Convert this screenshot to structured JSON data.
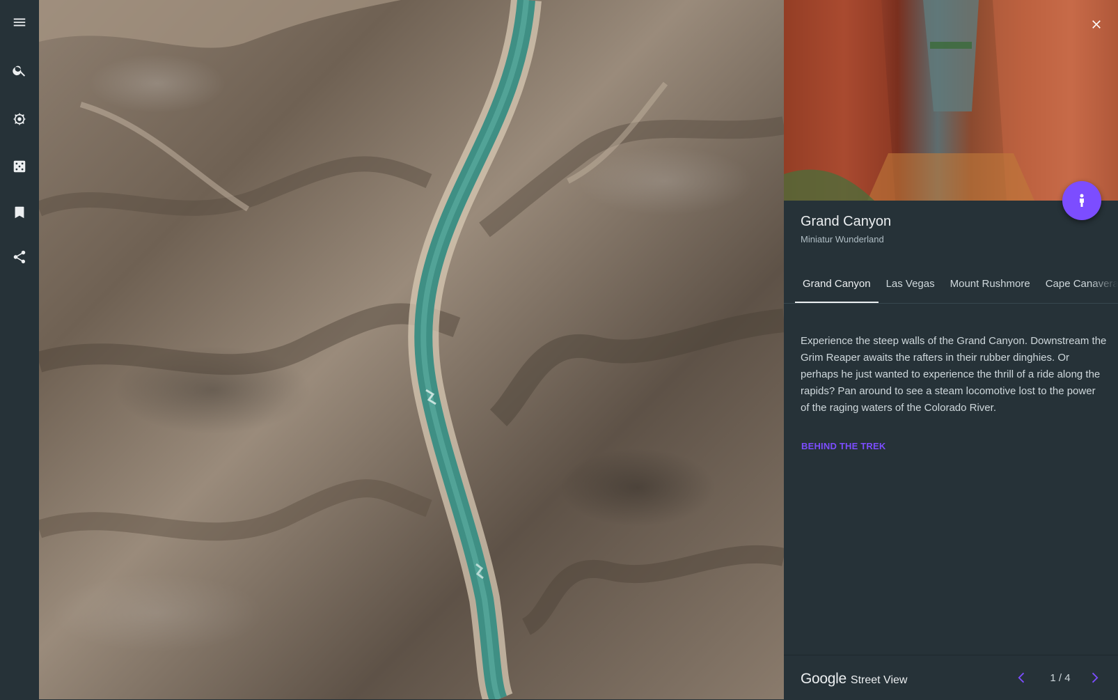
{
  "rail": {
    "items": [
      {
        "icon": "menu-icon"
      },
      {
        "icon": "search-icon"
      },
      {
        "icon": "ship-wheel-icon"
      },
      {
        "icon": "dice-icon"
      },
      {
        "icon": "bookmark-icon"
      },
      {
        "icon": "share-icon"
      }
    ]
  },
  "panel": {
    "title": "Grand Canyon",
    "subtitle": "Miniatur Wunderland",
    "tabs": [
      {
        "label": "Grand Canyon",
        "active": true
      },
      {
        "label": "Las Vegas",
        "active": false
      },
      {
        "label": "Mount Rushmore",
        "active": false
      },
      {
        "label": "Cape Canaveral",
        "active": false
      }
    ],
    "description": "Experience the steep walls of the Grand Canyon. Downstream the Grim Reaper awaits the rafters in their rubber dinghies. Or perhaps he just wanted to experience the thrill of a ride along the rapids? Pan around to see a steam locomotive lost to the power of the raging waters of the Colorado River.",
    "link_label": "BEHIND THE TREK",
    "accent_color": "#7c4dff"
  },
  "footer": {
    "brand_google": "Google",
    "brand_product": "Street View",
    "pager": "1 / 4"
  }
}
